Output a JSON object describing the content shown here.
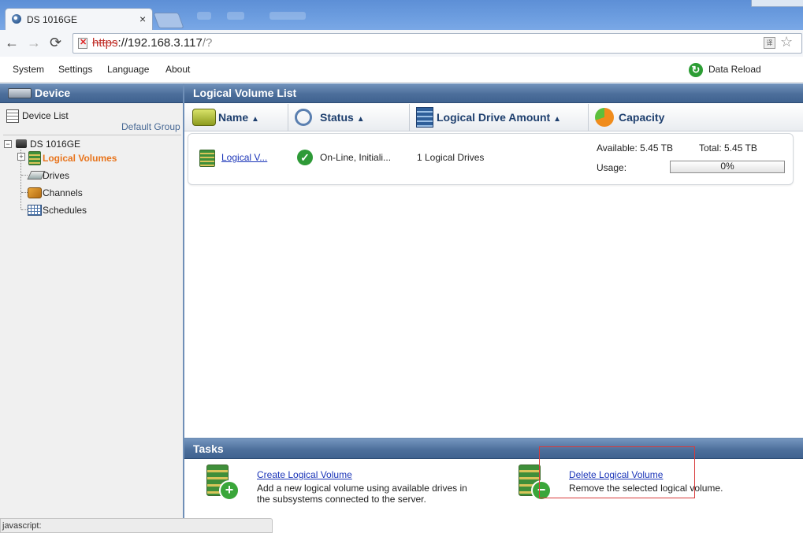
{
  "browser": {
    "tab_title": "DS 1016GE",
    "close_glyph": "×",
    "url_scheme": "https",
    "url_host": "://192.168.3.117",
    "url_path": "/?"
  },
  "menu": {
    "items": [
      "System",
      "Settings",
      "Language",
      "About"
    ],
    "reload_label": "Data Reload"
  },
  "left_panel": {
    "title": "Device",
    "device_list": "Device List",
    "group": "Default Group",
    "tree": {
      "root": "DS 1016GE",
      "items": [
        "Logical Volumes",
        "Drives",
        "Channels",
        "Schedules"
      ],
      "selected": "Logical Volumes"
    }
  },
  "main_panel": {
    "title": "Logical Volume List",
    "columns": [
      "Name",
      "Status",
      "Logical Drive Amount",
      "Capacity"
    ],
    "sort_glyph": "▲",
    "rows": [
      {
        "name": "Logical V...",
        "status": "On-Line, Initiali...",
        "drive_amount": "1 Logical Drives",
        "available": "Available: 5.45 TB",
        "total": "Total: 5.45 TB",
        "usage_label": "Usage:",
        "usage_text": "0%",
        "usage_fraction": 0
      }
    ]
  },
  "tasks": {
    "title": "Tasks",
    "items": [
      {
        "label": "Create Logical Volume",
        "desc1": "Add a new logical volume using available drives in",
        "desc2": "the subsystems connected to the server."
      },
      {
        "label": "Delete Logical Volume",
        "desc1": "Remove the selected logical volume.",
        "desc2": ""
      }
    ]
  },
  "status_bar": "javascript:",
  "colors": {
    "header_blue": "#4d6f9b",
    "selected_orange": "#e8741c",
    "link_blue": "#1a34b8",
    "highlight_red": "#d83a3a"
  }
}
